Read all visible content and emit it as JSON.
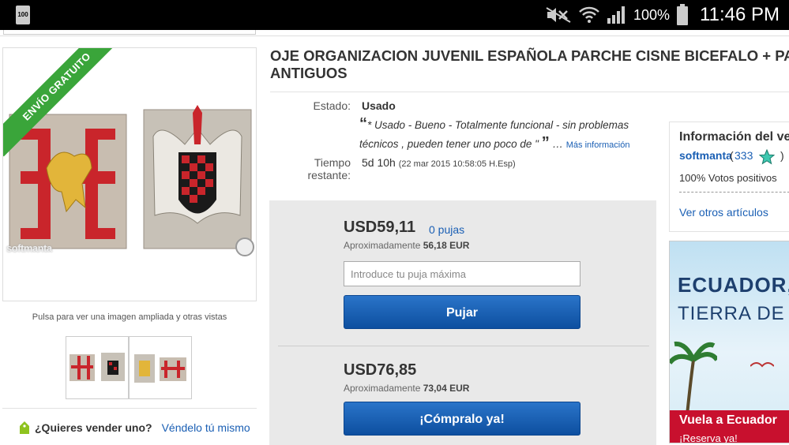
{
  "status_bar": {
    "battery_small": "100",
    "battery_pct": "100%",
    "time": "11:46 PM",
    "icons": [
      "mute-icon",
      "wifi-icon",
      "signal-icon",
      "battery-icon"
    ]
  },
  "gallery": {
    "ribbon": "ENVÍO GRATUITO",
    "watermark": "softmanta",
    "caption": "Pulsa para ver una imagen ampliada y otras vistas"
  },
  "sell": {
    "question": "¿Quieres vender uno?",
    "link": "Véndelo tú mismo"
  },
  "item": {
    "title_line1": "OJE ORGANIZACION JUVENIL ESPAÑOLA PARCHE CISNE BICEFALO + PARC",
    "title_line2": "ANTIGUOS",
    "condition_label": "Estado:",
    "condition_value": "Usado",
    "description": "* Usado - Bueno - Totalmente funcional - sin problemas técnicos , pueden tener uno poco de \"",
    "more_info": "Más información",
    "time_label": "Tiempo restante:",
    "time_value": "5d 10h",
    "time_detail": "(22 mar 2015   10:58:05 H.Esp)"
  },
  "bid": {
    "price": "USD59,11",
    "bids": "0 pujas",
    "approx_label": "Aproximadamente",
    "approx_value": "56,18 EUR",
    "input_placeholder": "Introduce tu puja máxima",
    "bid_button": "Pujar"
  },
  "buy_now": {
    "price": "USD76,85",
    "approx_label": "Aproximadamente",
    "approx_value": "73,04 EUR",
    "button": "¡Cómpralo ya!"
  },
  "seller": {
    "heading": "Información del ve",
    "name": "softmanta",
    "score": "333",
    "positive": "100% Votos positivos",
    "other_items": "Ver otros artículos"
  },
  "ad": {
    "line1": "ECUADOR,",
    "line2": "TIERRA DE C",
    "cta": "Vuela a Ecuador",
    "cta2": "¡Reserva ya!"
  }
}
